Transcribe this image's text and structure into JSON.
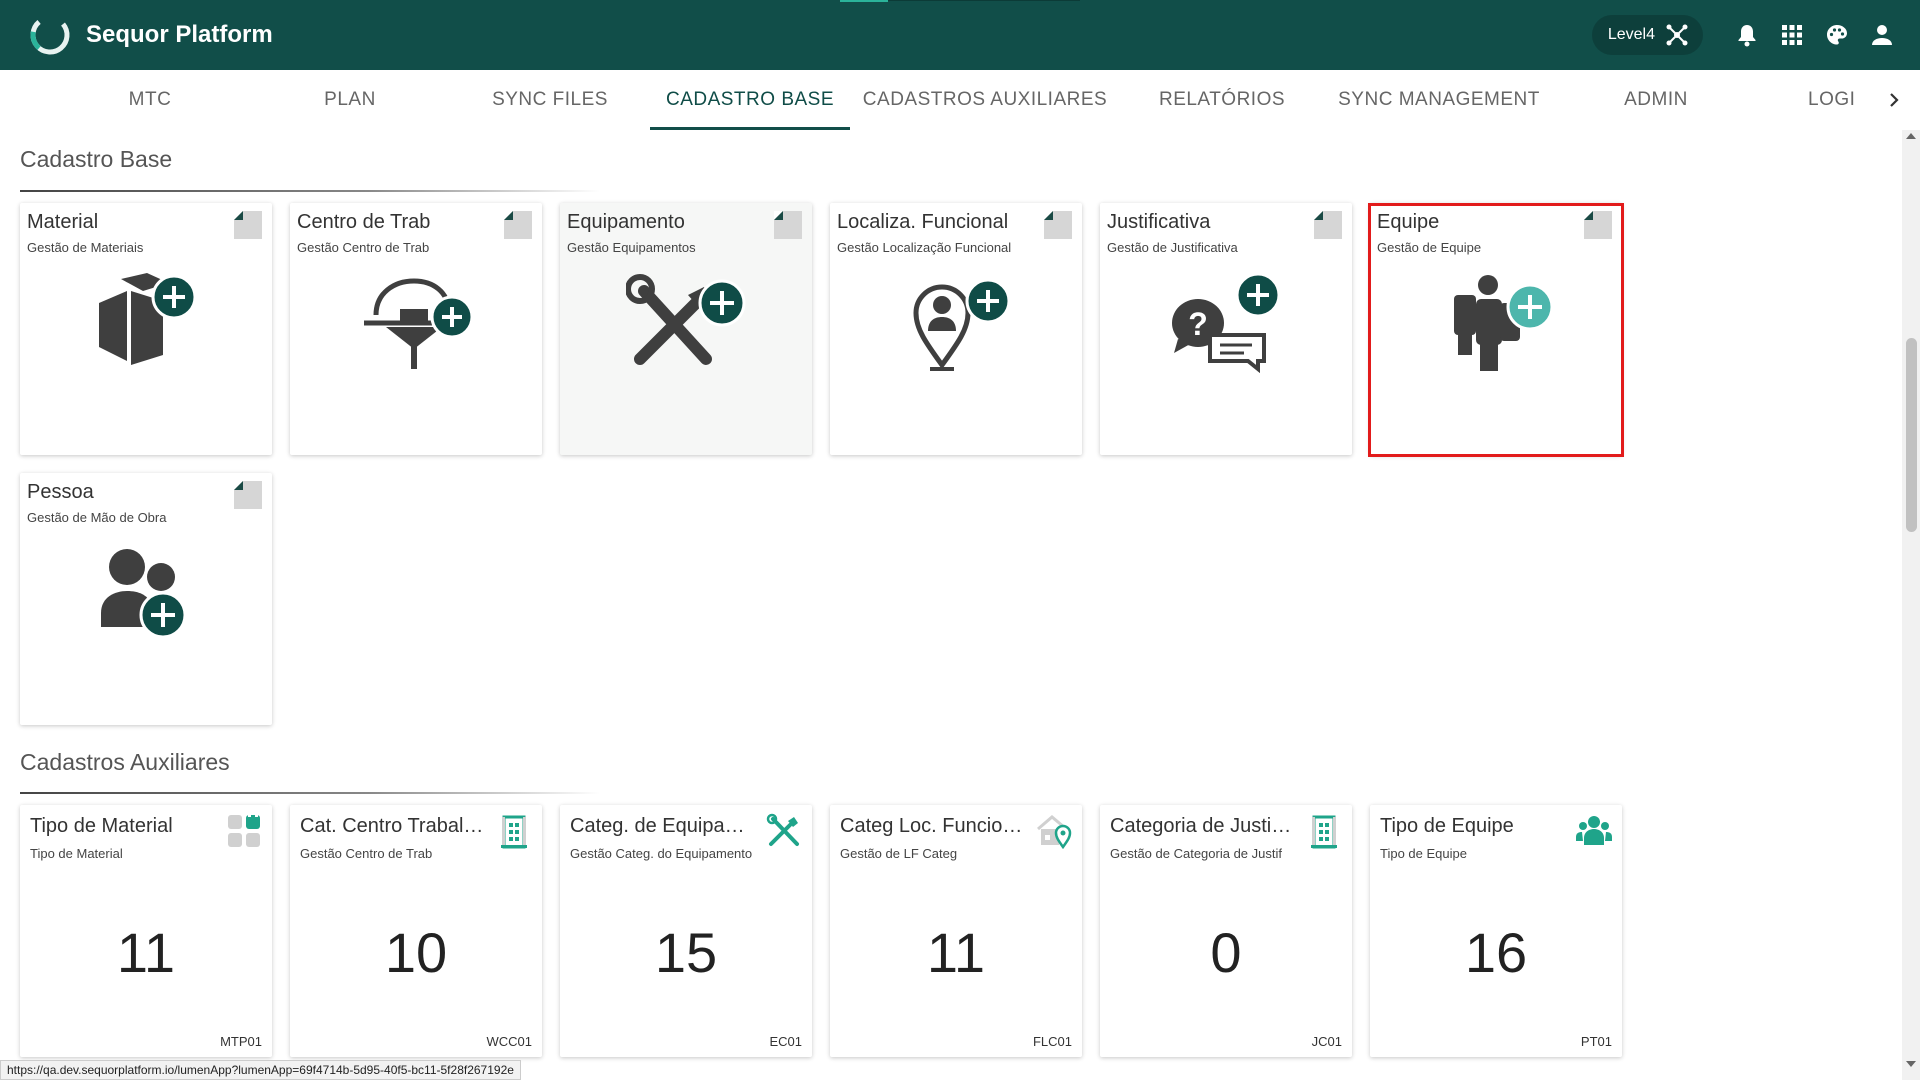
{
  "app": {
    "title": "Sequor Platform",
    "level_label": "Level4"
  },
  "colors": {
    "brand": "#114e49",
    "accent": "#2bb39a",
    "icon_dark": "#3f3f3f",
    "plus_bg": "#0f4c47",
    "highlight": "#e21b1b"
  },
  "topbar_icons": [
    "network-icon",
    "bell-icon",
    "apps-grid-icon",
    "palette-icon",
    "user-icon"
  ],
  "tabs": [
    {
      "label": "MTC"
    },
    {
      "label": "PLAN"
    },
    {
      "label": "SYNC FILES"
    },
    {
      "label": "CADASTRO BASE",
      "active": true
    },
    {
      "label": "CADASTROS AUXILIARES"
    },
    {
      "label": "RELATÓRIOS"
    },
    {
      "label": "SYNC MANAGEMENT"
    },
    {
      "label": "ADMIN"
    },
    {
      "label": "LOGI"
    }
  ],
  "sections": {
    "base": {
      "title": "Cadastro Base",
      "cards": [
        {
          "title": "Material",
          "subtitle": "Gestão de Materiais",
          "icon": "box-plus-icon"
        },
        {
          "title": "Centro de Trab",
          "subtitle": "Gestão Centro de Trab",
          "icon": "workcenter-plus-icon"
        },
        {
          "title": "Equipamento",
          "subtitle": "Gestão Equipamentos",
          "icon": "tools-plus-icon"
        },
        {
          "title": "Localiza. Funcional",
          "subtitle": "Gestão Localização Funcional",
          "icon": "location-person-plus-icon"
        },
        {
          "title": "Justificativa",
          "subtitle": "Gestão de Justificativa",
          "icon": "chat-question-plus-icon"
        },
        {
          "title": "Equipe",
          "subtitle": "Gestão de Equipe",
          "icon": "team-plus-icon"
        },
        {
          "title": "Pessoa",
          "subtitle": "Gestão de Mão de Obra",
          "icon": "people-plus-icon"
        }
      ]
    },
    "aux": {
      "title": "Cadastros Auxiliares",
      "cards": [
        {
          "title": "Tipo de Material",
          "subtitle": "Tipo de Material",
          "count": "11",
          "code": "MTP01",
          "icon": "blocks-icon"
        },
        {
          "title": "Cat. Centro Trabalho",
          "subtitle": "Gestão Centro de Trab",
          "count": "10",
          "code": "WCC01",
          "icon": "building-icon"
        },
        {
          "title": "Categ. de Equipamento",
          "subtitle": "Gestão Categ. do Equipamento",
          "count": "15",
          "code": "EC01",
          "icon": "tools-icon"
        },
        {
          "title": "Categ Loc. Funcional",
          "subtitle": "Gestão de LF Categ",
          "count": "11",
          "code": "FLC01",
          "icon": "home-location-icon"
        },
        {
          "title": "Categoria de Justificativa",
          "subtitle": "Gestão de Categoria de Justif",
          "count": "0",
          "code": "JC01",
          "icon": "building-icon"
        },
        {
          "title": "Tipo de Equipe",
          "subtitle": "Tipo de Equipe",
          "count": "16",
          "code": "PT01",
          "icon": "group-icon"
        }
      ]
    }
  },
  "status_url": "https://qa.dev.sequorplatform.io/lumenApp?lumenApp=69f4714b-5d95-40f5-bc11-5f28f267192e"
}
